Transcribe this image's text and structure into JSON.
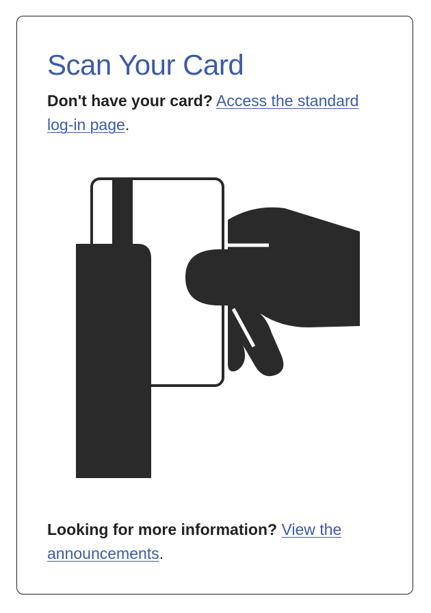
{
  "scan_card": {
    "title": "Scan Your Card",
    "no_card_prompt": "Don't have your card?",
    "standard_login_link": "Access the standard log-in page",
    "no_card_suffix": ".",
    "info_prompt": "Looking for more information?",
    "announcements_link": "View the announcements",
    "info_suffix": "."
  },
  "colors": {
    "title": "#3b5ba9",
    "link": "#3b5ba9",
    "text": "#222222",
    "illustration": "#2b2a2a"
  },
  "icons": {
    "illustration": "hand-swiping-card-reader-icon"
  }
}
